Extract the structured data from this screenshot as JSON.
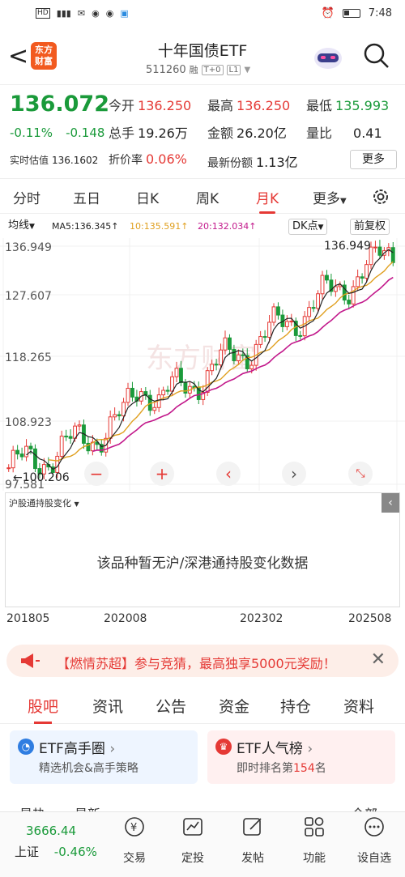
{
  "status": {
    "left_icons": [
      "HD",
      "4G",
      "signal",
      "message",
      "wechat",
      "wechat",
      "app"
    ],
    "time": "7:48"
  },
  "header": {
    "title": "十年国债ETF",
    "code": "511260",
    "tags": [
      "融",
      "T+0",
      "L1"
    ],
    "logo": "东方财富"
  },
  "quote": {
    "price": "136.072",
    "change_pct": "-0.11%",
    "change": "-0.148",
    "open_label": "今开",
    "open": "136.250",
    "high_label": "最高",
    "high": "136.250",
    "low_label": "最低",
    "low": "135.993",
    "volume_label": "总手",
    "volume": "19.26万",
    "amount_label": "金额",
    "amount": "26.20亿",
    "ratio_label": "量比",
    "ratio": "0.41",
    "iopv_label": "实时估值",
    "iopv": "136.1602",
    "discount_label": "折价率",
    "discount": "0.06%",
    "shares_label": "最新份额",
    "shares": "1.13亿",
    "more_label": "更多"
  },
  "period_tabs": [
    "分时",
    "五日",
    "日K",
    "周K",
    "月K",
    "更多"
  ],
  "ma": {
    "type_label": "均线",
    "ma5": "MA5:136.345↑",
    "ma10": "10:135.591↑",
    "ma20": "20:132.034↑",
    "dk_label": "DK点",
    "fq_label": "前复权"
  },
  "chart_data": {
    "type": "candlestick",
    "y_ticks": [
      "136.949",
      "127.607",
      "118.265",
      "108.923",
      "97.581"
    ],
    "high_label": "136.949",
    "low_label": "100.206",
    "x_labels": [
      "201805",
      "202008",
      "202302",
      "202508"
    ],
    "ylim": [
      97.581,
      136.949
    ]
  },
  "hk": {
    "selector": "沪股通持股变化",
    "message": "该品种暂无沪/深港通持股变化数据"
  },
  "banner": {
    "text": "【燃情苏超】参与竞猜，最高独享5000元奖励！"
  },
  "bottom_tabs": [
    "股吧",
    "资讯",
    "公告",
    "资金",
    "持仓",
    "资料"
  ],
  "cards": [
    {
      "title": "ETF高手圈",
      "sub": "精选机会&高手策略"
    },
    {
      "title": "ETF人气榜",
      "sub_prefix": "即时排名第",
      "rank": "154",
      "sub_suffix": "名"
    }
  ],
  "sort": {
    "hot": "最热",
    "new": "最新",
    "all": "全部"
  },
  "nav": {
    "index_value": "3666.44",
    "index_name": "上证",
    "index_change": "-0.46%",
    "items": [
      "交易",
      "定投",
      "发帖",
      "功能",
      "设自选"
    ]
  }
}
